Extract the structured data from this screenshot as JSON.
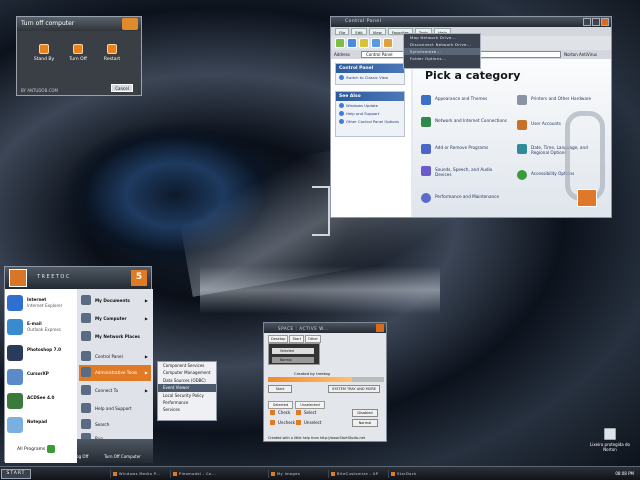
{
  "shutdown": {
    "title": "Turn off computer",
    "options": [
      "Stand By",
      "Turn Off",
      "Restart"
    ],
    "brand": "BY ANTUDOB.COM",
    "cancel_label": "Cancel"
  },
  "control_panel": {
    "title": "Control Panel",
    "menus": [
      "File",
      "Edit",
      "View",
      "Favorites",
      "Tools",
      "Help"
    ],
    "address_label": "Address",
    "address_value": "Control Panel",
    "address_right": "Norton AntiVirus",
    "tools_menu": [
      "Map Network Drive...",
      "Disconnect Network Drive...",
      "Synchronize...",
      "Folder Options..."
    ],
    "sidebar": {
      "panel1_title": "Control Panel",
      "panel1_items": [
        "Switch to Classic View"
      ],
      "panel2_title": "See Also",
      "panel2_items": [
        "Windows Update",
        "Help and Support",
        "Other Control Panel Options"
      ]
    },
    "heading": "Pick a category",
    "categories": [
      "Appearance and Themes",
      "Network and Internet Connections",
      "Add or Remove Programs",
      "Sounds, Speech, and Audio Devices",
      "Performance and Maintenance",
      "Printers and Other Hardware",
      "User Accounts",
      "Date, Time, Language, and Regional Options",
      "Accessibility Options"
    ]
  },
  "start_menu": {
    "user": "TREETOC",
    "badge": "5",
    "pinned": [
      {
        "title": "Internet",
        "sub": "Internet Explorer"
      },
      {
        "title": "E-mail",
        "sub": "Outlook Express"
      },
      {
        "title": "Photoshop 7.0",
        "sub": ""
      },
      {
        "title": "CursorXP",
        "sub": ""
      },
      {
        "title": "ACDSee 4.0",
        "sub": ""
      },
      {
        "title": "Notepad",
        "sub": ""
      }
    ],
    "all_programs": "All Programs",
    "places": [
      "My Documents",
      "My Computer",
      "My Network Places",
      "Control Panel",
      "Administrative Tools",
      "Connect To",
      "Help and Support",
      "Search",
      "Run..."
    ],
    "log_off": "Log Off",
    "turn_off": "Turn Off Computer"
  },
  "admin_tools": [
    "Component Services",
    "Computer Management",
    "Data Sources (ODBC)",
    "Event Viewer",
    "Local Security Policy",
    "Performance",
    "Services"
  ],
  "style_window": {
    "title": "SPACE : ACTIVE W...",
    "tabs": [
      "Desktop",
      "Start",
      "Other"
    ],
    "preview_selected": "Selected",
    "preview_normal": "Normal",
    "byline": "Created by treetog",
    "progress": 0.72,
    "buttons": [
      "Start",
      "SYSTEM TRAY AND MORE"
    ],
    "sel_tabs": [
      "Selected",
      "Unselected"
    ],
    "check": "Check",
    "select": "Select",
    "uncheck": "Uncheck",
    "unselect": "Unselect",
    "btn1": "Disabled",
    "btn2": "Normal",
    "footer": "Created with a little help from http://www.StartStudio.net"
  },
  "recycle_bin": "Lixeira protegida do Norton",
  "taskbar": {
    "start": "START",
    "tasks": [
      "Windows Media P...",
      "Pleomodel - Co...",
      "My Images",
      "BiteCustomize - XP",
      "StarDock WindowBlinds"
    ],
    "clock": "08:08 PM"
  }
}
